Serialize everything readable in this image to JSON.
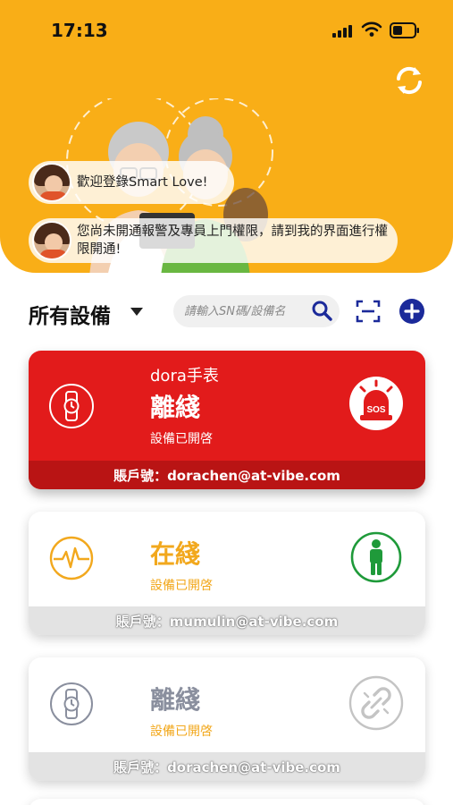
{
  "status_bar": {
    "time": "17:13"
  },
  "banner": {
    "messages": [
      {
        "text": "歡迎登錄Smart Love!"
      },
      {
        "text": "您尚未開通報警及專員上門權限，請到我的界面進行權限開通!"
      }
    ]
  },
  "toolbar": {
    "title": "所有設備",
    "search_placeholder": "請輸入SN碼/設備名"
  },
  "devices": [
    {
      "name": "dora手表",
      "status": "離綫",
      "sub": "設備已開啓",
      "account": "賬戶號：dorachen@at-vibe.com",
      "left_icon": "watch-icon",
      "right_icon": "sos-alarm-icon",
      "theme": "#E21B1B"
    },
    {
      "name": "",
      "status": "在綫",
      "sub": "設備已開啓",
      "account": "賬戶號：mumulin@at-vibe.com",
      "left_icon": "heartbeat-icon",
      "right_icon": "person-standing-icon",
      "theme": "#F2A81D"
    },
    {
      "name": "",
      "status": "離綫",
      "sub": "設備已開啓",
      "account": "賬戶號：dorachen@at-vibe.com",
      "left_icon": "watch-icon",
      "right_icon": "broken-link-icon",
      "theme": "#8a8f9e"
    }
  ],
  "colors": {
    "header": "#F9AE17",
    "accent_blue": "#1b2a9a",
    "alert_red": "#E21B1B",
    "online_yellow": "#F2A81D",
    "offline_gray": "#8a8f9e",
    "person_green": "#1f9a3a"
  }
}
